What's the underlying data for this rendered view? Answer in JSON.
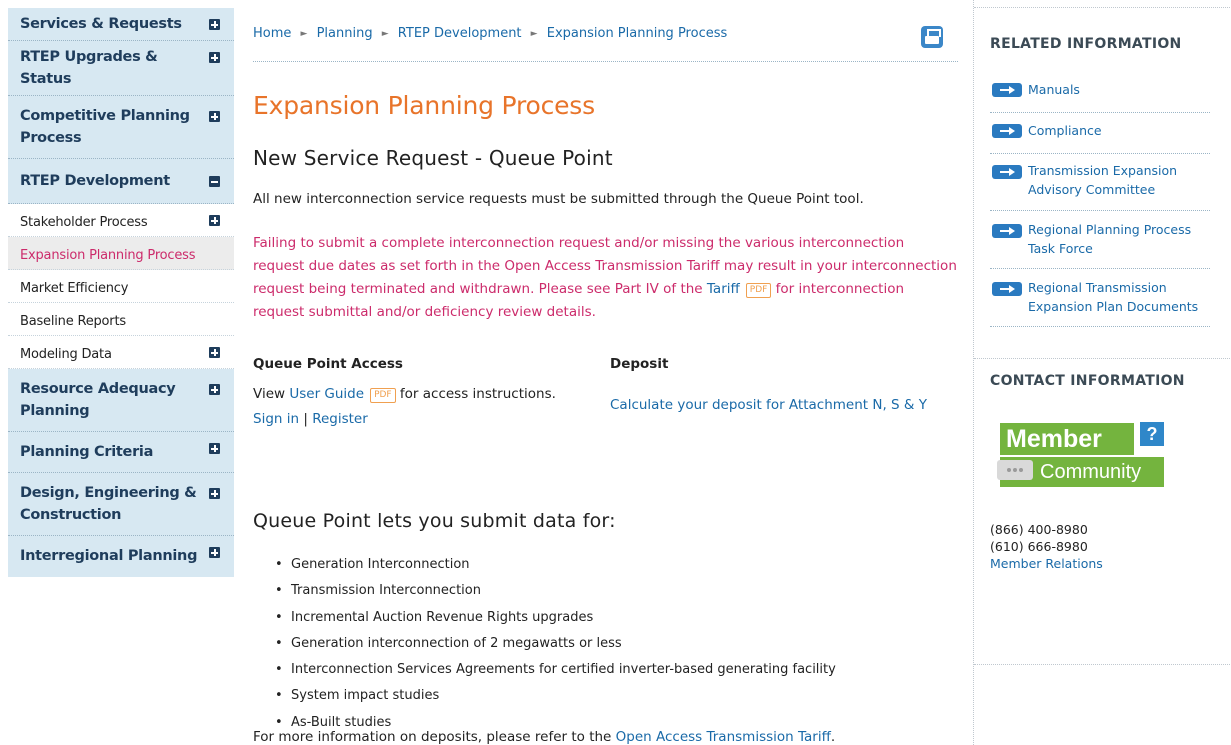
{
  "nav": {
    "items": [
      {
        "label": "Services & Requests",
        "toggle": "+"
      },
      {
        "label": "RTEP Upgrades & Status",
        "toggle": "+"
      },
      {
        "label": "Competitive Planning Process",
        "toggle": "+"
      },
      {
        "label": "RTEP Development",
        "toggle": "-"
      },
      {
        "label": "Stakeholder Process",
        "toggle": "+"
      },
      {
        "label": "Expansion Planning Process"
      },
      {
        "label": "Market Efficiency"
      },
      {
        "label": "Baseline Reports"
      },
      {
        "label": "Modeling Data",
        "toggle": "+"
      },
      {
        "label": "Resource Adequacy Planning",
        "toggle": "+"
      },
      {
        "label": "Planning Criteria",
        "toggle": "+"
      },
      {
        "label": "Design, Engineering & Construction",
        "toggle": "+"
      },
      {
        "label": "Interregional Planning",
        "toggle": "+"
      }
    ]
  },
  "breadcrumb": {
    "items": [
      "Home",
      "Planning",
      "RTEP Development",
      "Expansion Planning Process"
    ],
    "separator": "►"
  },
  "main": {
    "page_title": "Expansion Planning Process",
    "section_title": "New Service Request - Queue Point",
    "intro": "All new interconnection service requests must be submitted through the Queue Point tool.",
    "warning": {
      "text": "Failing to submit a complete interconnection request and/or missing the various interconnection request due dates as set forth in the Open Access Transmission Tariff may result in your interconnection request being terminated and withdrawn. Please see Part IV of the",
      "link": "Tariff",
      "pdf": "PDF",
      "text_after": "for interconnection request submittal and/or deficiency review details."
    },
    "queue_point_access": {
      "heading": "Queue Point Access",
      "view": "View",
      "user_guide": "User Guide",
      "pdf": "PDF",
      "instructions": "for access instructions.",
      "sign_in": "Sign in",
      "divider": "|",
      "register": "Register"
    },
    "deposit": {
      "heading": "Deposit",
      "link": "Calculate your deposit for Attachment N, S & Y"
    },
    "list_title": "Queue Point lets you submit data for:",
    "list": [
      "Generation Interconnection",
      "Transmission Interconnection",
      "Incremental Auction Revenue Rights upgrades",
      "Generation interconnection of 2 megawatts or less",
      "Interconnection Services Agreements for certified inverter-based generating facility",
      "System impact studies",
      "As-Built studies"
    ],
    "footer": {
      "text": "For more information on deposits, please refer to the",
      "link": "Open Access Transmission Tariff",
      "end": "."
    }
  },
  "right": {
    "related_heading": "RELATED INFORMATION",
    "related": [
      "Manuals",
      "Compliance",
      "Transmission Expansion Advisory Committee",
      "Regional Planning Process Task Force",
      "Regional Transmission Expansion Plan Documents"
    ],
    "contact_heading": "CONTACT INFORMATION",
    "member_logo": {
      "word1": "Member",
      "q": "?",
      "word2": "Community"
    },
    "phone1": "(866) 400-8980",
    "phone2": "(610) 666-8980",
    "member_relations": "Member Relations"
  },
  "colors": {
    "title_orange": "#e8742a",
    "warning_pink": "#cc2b6b",
    "link_blue": "#1a6aa8",
    "nav_bg": "#d7e8f2",
    "nav_text": "#1f3d5c",
    "logo_green": "#74b43e"
  },
  "icons": {
    "print": "print-icon",
    "related_arrow": "arrow-right-icon",
    "toggle_expand": "plus-icon",
    "toggle_collapse": "minus-icon"
  }
}
